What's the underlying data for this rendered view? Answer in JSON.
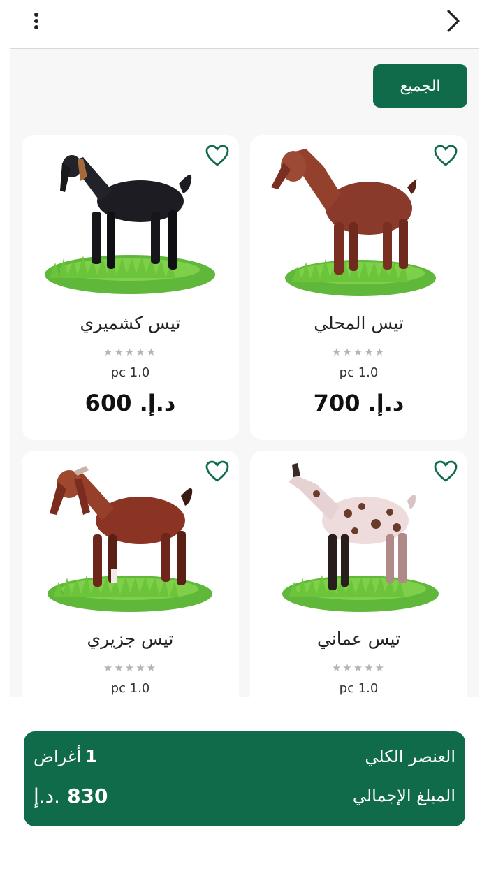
{
  "header": {
    "back_icon": "chevron-right-icon",
    "menu_icon": "more-vertical-icon"
  },
  "filter": {
    "label": "الجميع",
    "color": "#0f6b4a"
  },
  "products": [
    {
      "name": "تيس المحلي",
      "rating": 0,
      "unit": "pc 1.0",
      "price": "د.إ. 700"
    },
    {
      "name": "تيس كشميري",
      "rating": 0,
      "unit": "pc 1.0",
      "price": "د.إ. 600"
    },
    {
      "name": "تيس عماني",
      "rating": 0,
      "unit": "pc 1.0",
      "price": ""
    },
    {
      "name": "تيس جزيري",
      "rating": 0,
      "unit": "pc 1.0",
      "price": ""
    }
  ],
  "summary": {
    "items_label": "العنصر الكلي",
    "items_count": "1",
    "items_unit": "أغراض",
    "total_label": "المبلغ الإجمالي",
    "total_currency": "د.إ.",
    "total_value": "830"
  },
  "colors": {
    "accent": "#0f6b4a",
    "grass": "#6cc43a"
  }
}
